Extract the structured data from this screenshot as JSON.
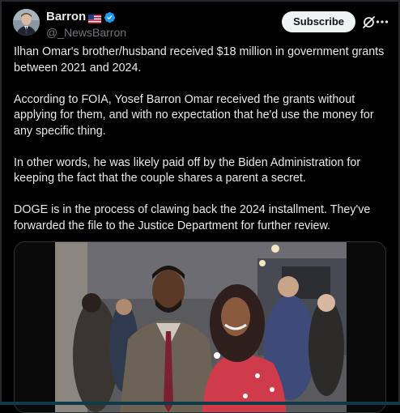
{
  "author": {
    "display_name": "Barron",
    "flag_icon": "us-flag-icon",
    "verified_icon": "verified-badge-icon",
    "handle": "@_NewsBarron"
  },
  "actions": {
    "subscribe_label": "Subscribe",
    "grok_icon": "grok-icon",
    "more_icon": "more-icon"
  },
  "tweet": {
    "paragraphs": [
      "Ilhan Omar's brother/husband received $18 million in government grants between 2021 and 2024.",
      "According to FOIA, Yosef Barron Omar received the grants without applying for them, and with no expectation that he'd use the money for any specific thing.",
      "In other words, he was likely paid off by the Biden Administration for keeping the fact that the couple shares a parent a secret.",
      "DOGE is in the process of clawing back the 2024 installment. They've forwarded the file to the Justice Department for further review."
    ]
  },
  "colors": {
    "background": "#000000",
    "text": "#e7e9ea",
    "secondary_text": "#71767b",
    "verified": "#1d9bf0",
    "subscribe_bg": "#eff3f4"
  }
}
